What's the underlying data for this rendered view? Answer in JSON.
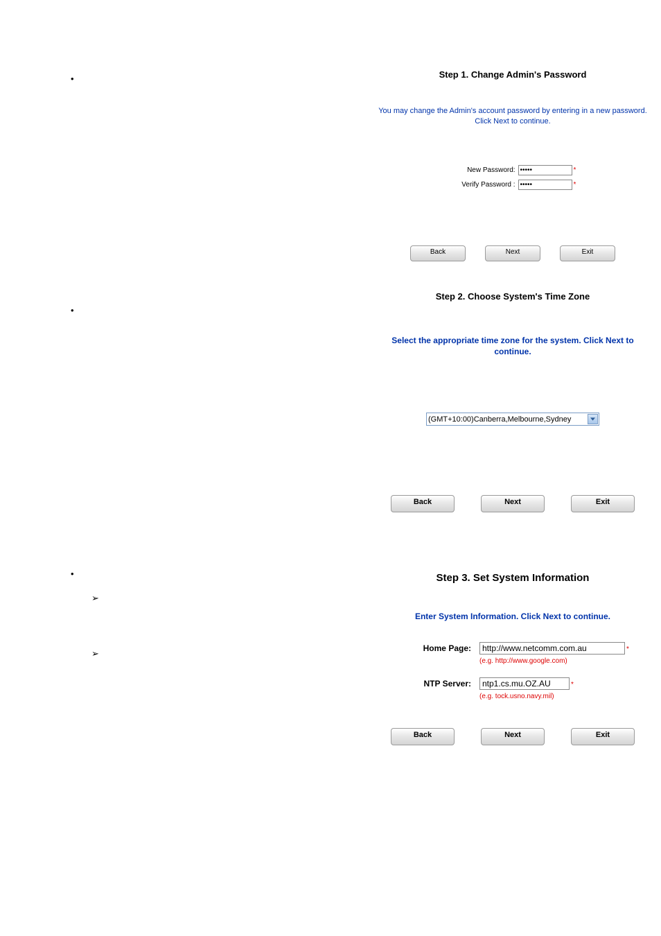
{
  "step1": {
    "title": "Step 1. Change Admin's Password",
    "instruction": "You may change the Admin's account password by entering in a new password. Click Next to continue.",
    "new_password_label": "New Password:",
    "verify_password_label": "Verify Password :",
    "new_password_value": "•••••",
    "verify_password_value": "•••••",
    "star": "*",
    "back": "Back",
    "next": "Next",
    "exit": "Exit"
  },
  "step2": {
    "title": "Step 2. Choose System's Time Zone",
    "instruction": "Select the appropriate time zone for the system. Click Next to continue.",
    "timezone_value": "(GMT+10:00)Canberra,Melbourne,Sydney",
    "back": "Back",
    "next": "Next",
    "exit": "Exit"
  },
  "step3": {
    "title": "Step 3. Set System Information",
    "instruction": "Enter System Information. Click Next to continue.",
    "home_page_label": "Home Page:",
    "home_page_value": "http://www.netcomm.com.au",
    "home_page_hint": "(e.g. http://www.google.com)",
    "ntp_label": "NTP Server:",
    "ntp_value": "ntp1.cs.mu.OZ.AU",
    "ntp_hint": "(e.g. tock.usno.navy.mil)",
    "star": "*",
    "back": "Back",
    "next": "Next",
    "exit": "Exit"
  }
}
